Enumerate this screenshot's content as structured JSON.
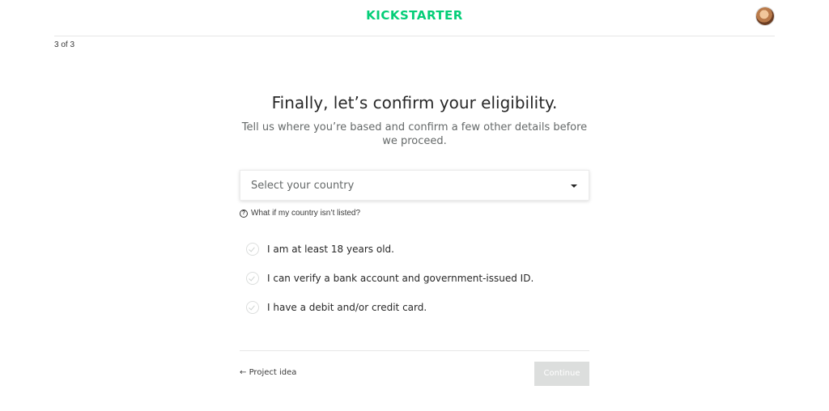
{
  "header": {
    "logo_text": "KICKSTARTER",
    "avatar_icon": "user-avatar"
  },
  "progress": {
    "step_text": "3 of 3"
  },
  "main": {
    "title": "Finally, let’s confirm your eligibility.",
    "subtitle": "Tell us where you’re based and confirm a few other details before we proceed.",
    "country_select": {
      "placeholder": "Select your country",
      "icon": "caret-down-icon"
    },
    "help_link": {
      "icon": "question-circle-icon",
      "label": "What if my country isn’t listed?"
    },
    "checklist": [
      {
        "label": "I am at least 18 years old.",
        "checked": false
      },
      {
        "label": "I can verify a bank account and government-issued ID.",
        "checked": false
      },
      {
        "label": "I have a debit and/or credit card.",
        "checked": false
      }
    ]
  },
  "footer": {
    "back_arrow": "←",
    "back_label": "Project idea",
    "continue_label": "Continue"
  },
  "colors": {
    "brand": "#05ce78",
    "disabled_button": "#dcdedd",
    "text": "#282828",
    "muted_text": "#656969"
  }
}
